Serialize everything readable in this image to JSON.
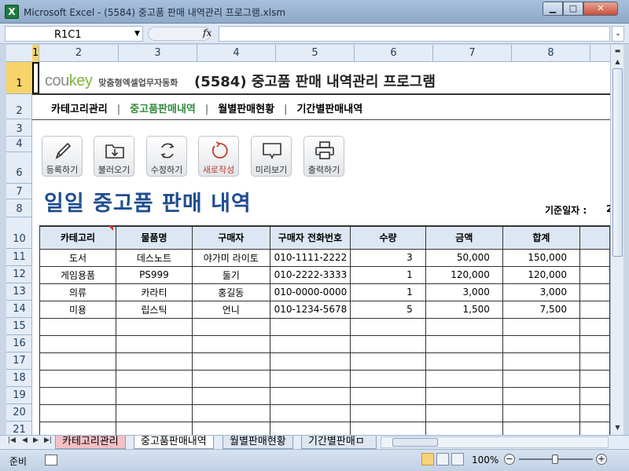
{
  "window": {
    "app_icon": "X",
    "title": "Microsoft Excel - (5584) 중고품 판매 내역관리 프로그램.xlsm",
    "minimize": "▁",
    "maximize": "□",
    "close": "✕"
  },
  "formula_bar": {
    "name_box": "R1C1",
    "fx": "fx",
    "formula": ""
  },
  "columns": [
    "1",
    "2",
    "3",
    "4",
    "5",
    "6",
    "7",
    "8"
  ],
  "rows": [
    "1",
    "2",
    "3",
    "4",
    "6",
    "7",
    "8",
    "10",
    "11",
    "12",
    "13",
    "14",
    "15",
    "16",
    "17",
    "18",
    "19",
    "20",
    "21"
  ],
  "sheet": {
    "brand_logo_a": "cou",
    "brand_logo_b": "key",
    "brand_tagline": "맞춤형엑셀업무자동화",
    "program_title": "(5584) 중고품 판매 내역관리 프로그램",
    "nav": [
      "카테고리관리",
      "중고품판매내역",
      "월별판매현황",
      "기간별판매내역"
    ],
    "nav_sep": "|",
    "tools": [
      "등록하기",
      "불러오기",
      "수정하기",
      "새로작성",
      "미리보기",
      "출력하기"
    ],
    "page_heading": "일일 중고품 판매 내역",
    "base_date_label": "기준일자 :",
    "base_date_value": "2"
  },
  "table": {
    "headers": [
      "카테고리",
      "물품명",
      "구매자",
      "구매자 전화번호",
      "수량",
      "금액",
      "합계"
    ],
    "rows": [
      [
        "도서",
        "데스노트",
        "야가미 라이토",
        "010-1111-2222",
        "3",
        "50,000",
        "150,000"
      ],
      [
        "게임용품",
        "PS999",
        "둘기",
        "010-2222-3333",
        "1",
        "120,000",
        "120,000"
      ],
      [
        "의류",
        "카라티",
        "홍길동",
        "010-0000-0000",
        "1",
        "3,000",
        "3,000"
      ],
      [
        "미용",
        "립스틱",
        "언니",
        "010-1234-5678",
        "5",
        "1,500",
        "7,500"
      ]
    ]
  },
  "sheet_tabs": [
    "카테고리관리",
    "중고품판매내역",
    "월별판매현황",
    "기간별판매ㅁ"
  ],
  "status": {
    "ready": "준비",
    "zoom": "100%",
    "zoom_minus": "−",
    "zoom_plus": "+"
  }
}
